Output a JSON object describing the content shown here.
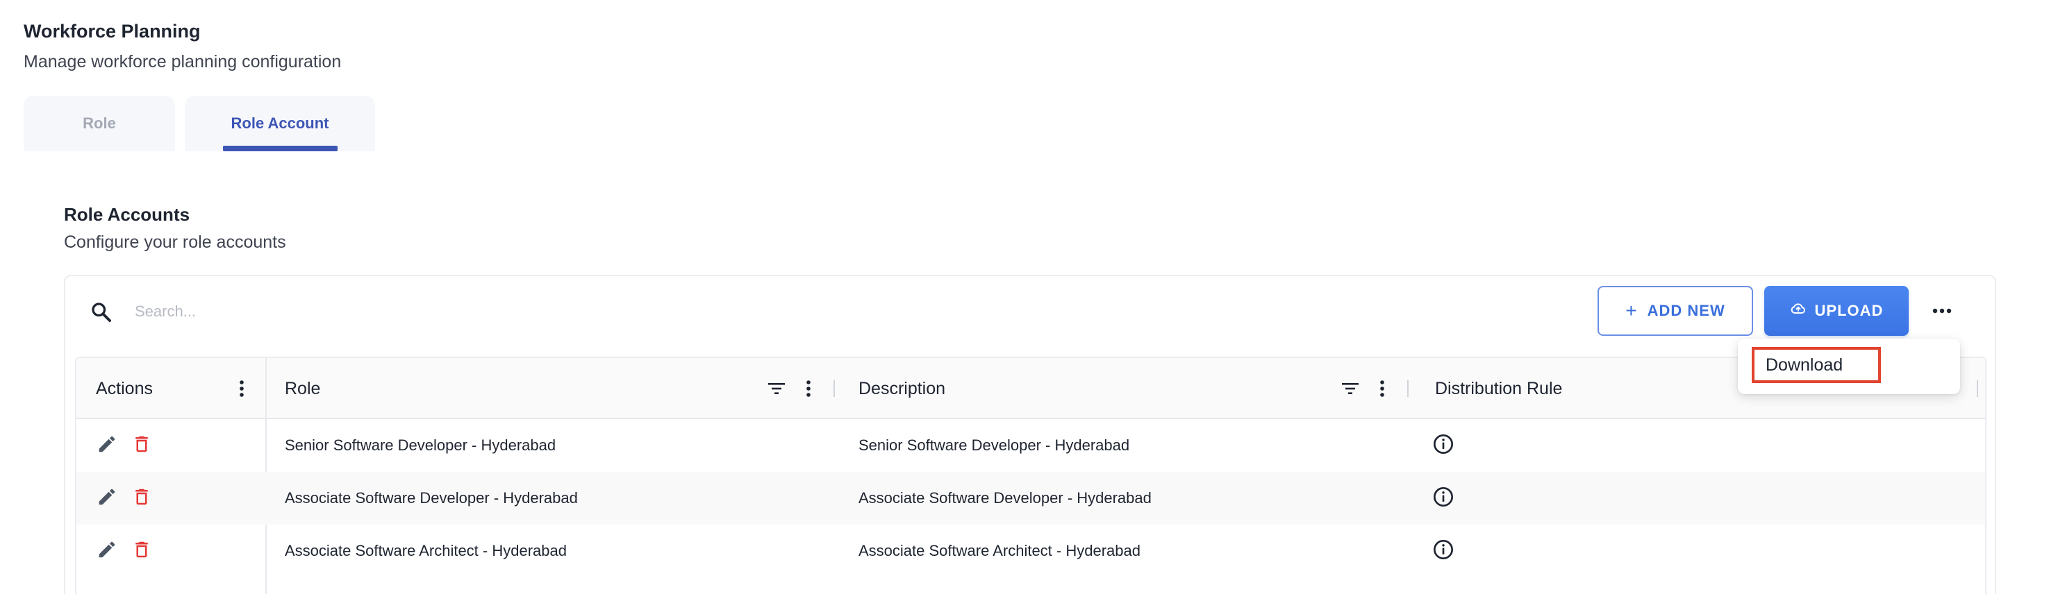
{
  "page": {
    "title": "Workforce Planning",
    "subtitle": "Manage workforce planning configuration"
  },
  "tabs": [
    {
      "label": "Role",
      "active": false
    },
    {
      "label": "Role Account",
      "active": true
    }
  ],
  "section": {
    "title": "Role Accounts",
    "subtitle": "Configure your role accounts"
  },
  "toolbar": {
    "search_placeholder": "Search...",
    "add_new_label": "ADD NEW",
    "upload_label": "UPLOAD"
  },
  "menu": {
    "items": [
      {
        "label": "Download"
      }
    ]
  },
  "table": {
    "columns": [
      {
        "label": "Actions"
      },
      {
        "label": "Role"
      },
      {
        "label": "Description"
      },
      {
        "label": "Distribution Rule"
      }
    ],
    "rows": [
      {
        "role": "Senior Software Developer - Hyderabad",
        "description": "Senior Software Developer - Hyderabad"
      },
      {
        "role": "Associate Software Developer - Hyderabad",
        "description": "Associate Software Developer - Hyderabad"
      },
      {
        "role": "Associate Software Architect - Hyderabad",
        "description": "Associate Software Architect - Hyderabad"
      }
    ]
  },
  "colors": {
    "accent": "#3d55b5",
    "primary_button": "#3b73e4",
    "delete_icon": "#e53935",
    "highlight_border": "#e2442f"
  },
  "icons": {
    "search": "search-icon",
    "edit": "pencil-icon",
    "delete": "trash-icon",
    "filter": "filter-icon",
    "column_menu": "vertical-dots-icon",
    "more": "horizontal-dots-icon",
    "upload": "cloud-upload-icon",
    "info": "info-icon"
  }
}
